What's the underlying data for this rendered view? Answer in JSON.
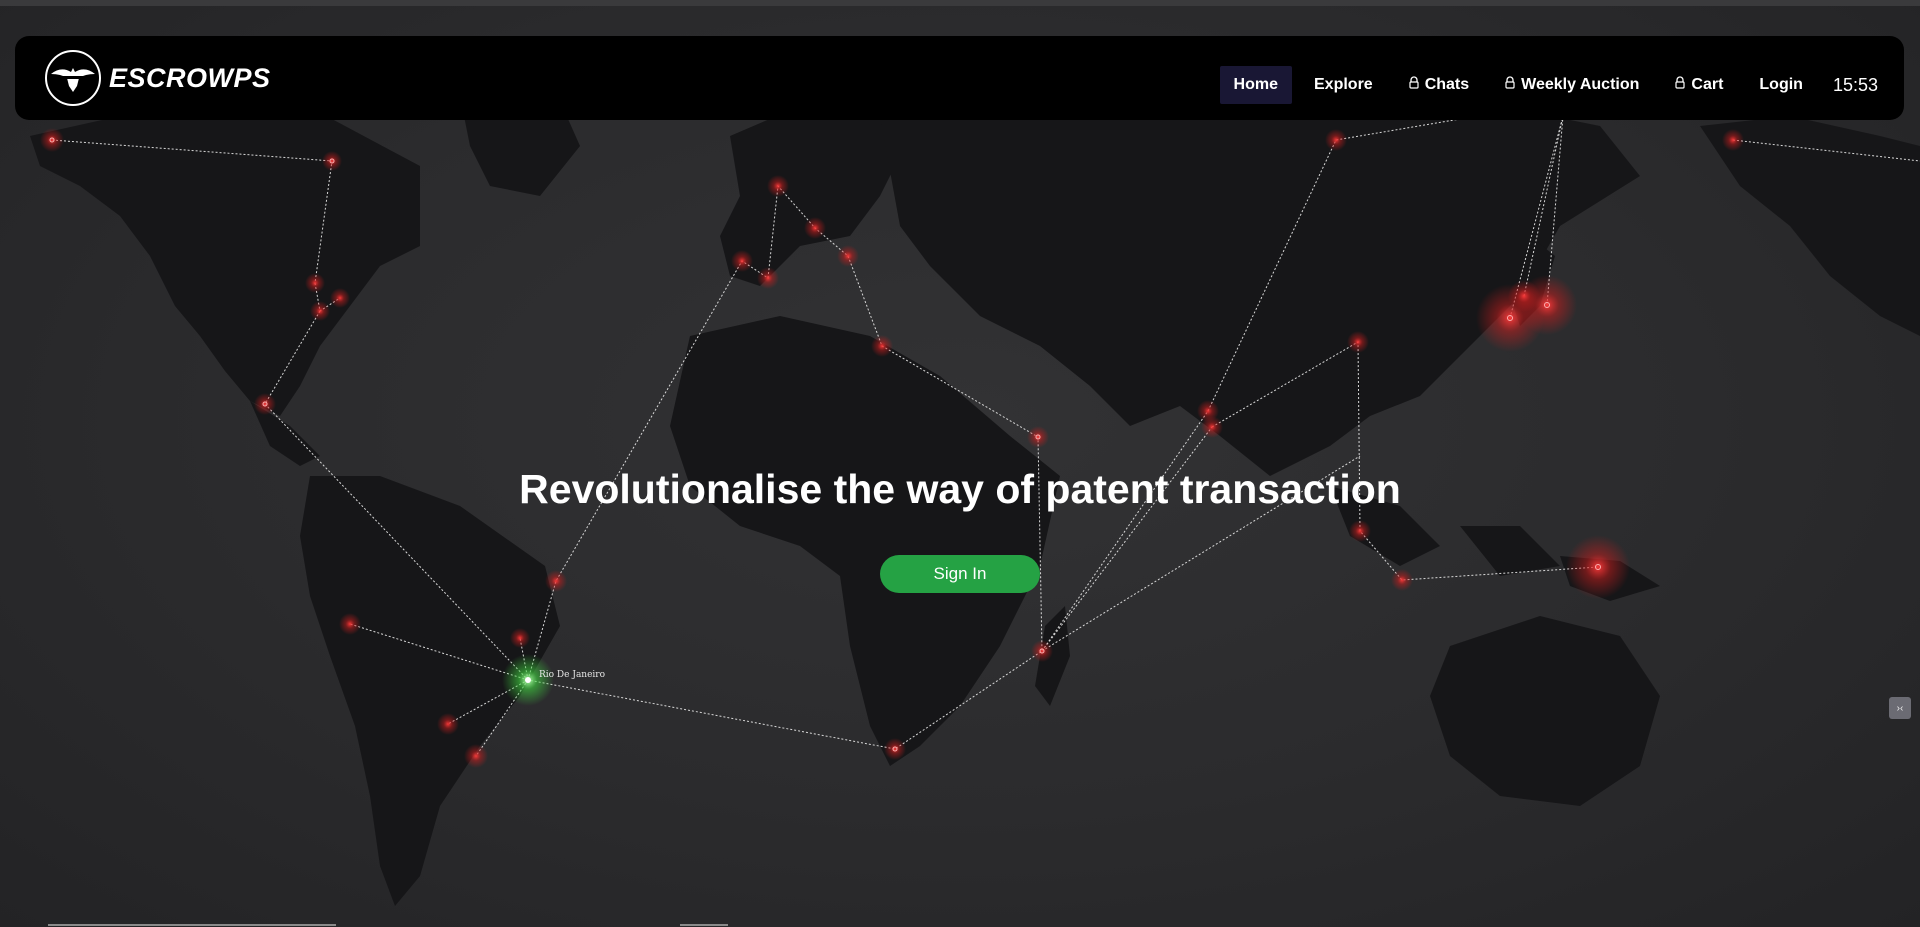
{
  "brand": {
    "name": "ESCROWPS",
    "mark_text": "ESCROWPS"
  },
  "nav": {
    "home": "Home",
    "explore": "Explore",
    "chats": "Chats",
    "weekly_auction": "Weekly Auction",
    "cart": "Cart",
    "login": "Login",
    "clock": "15:53"
  },
  "hero": {
    "title": "Revolutionalise the way of patent transaction",
    "signin": "Sign In"
  },
  "map": {
    "highlight_city": "Rio De Janeiro",
    "colors": {
      "node": "#e03a3a",
      "highlight": "#4cd44c",
      "land": "#161618",
      "ocean": "#2c2c2e"
    }
  },
  "side_button_label": "›‹"
}
